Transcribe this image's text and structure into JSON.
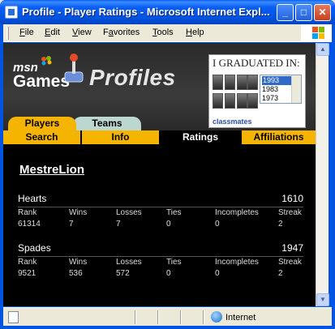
{
  "window": {
    "title": "Profile - Player Ratings - Microsoft Internet Expl...",
    "minimize": "_",
    "maximize": "□",
    "close": "✕"
  },
  "menu": [
    "File",
    "Edit",
    "View",
    "Favorites",
    "Tools",
    "Help"
  ],
  "menu_underline": [
    "F",
    "E",
    "V",
    "a",
    "T",
    "H"
  ],
  "banner": {
    "msn": "msn",
    "games": "Games",
    "profiles": "Profiles"
  },
  "ad": {
    "title": "I GRADUATED IN:",
    "years": [
      "1993",
      "1983",
      "1973"
    ],
    "selected_year": "1993",
    "brand": "classmates"
  },
  "tabs": [
    "Players",
    "Teams"
  ],
  "subnav": [
    "Search",
    "Info",
    "Ratings",
    "Affiliations"
  ],
  "active_subnav": "Ratings",
  "player": {
    "name": "MestreLion"
  },
  "columns": [
    "Rank",
    "Wins",
    "Losses",
    "Ties",
    "Incompletes",
    "Streak"
  ],
  "games": [
    {
      "name": "Hearts",
      "rating": "1610",
      "values": [
        "61314",
        "7",
        "7",
        "0",
        "0",
        "2"
      ]
    },
    {
      "name": "Spades",
      "rating": "1947",
      "values": [
        "9521",
        "536",
        "572",
        "0",
        "0",
        "2"
      ]
    }
  ],
  "status": {
    "zone": "Internet"
  },
  "colors": {
    "tab_active": "#f5b400",
    "tab_inactive": "#bcd6d0",
    "titlebar": "#0054e3"
  }
}
